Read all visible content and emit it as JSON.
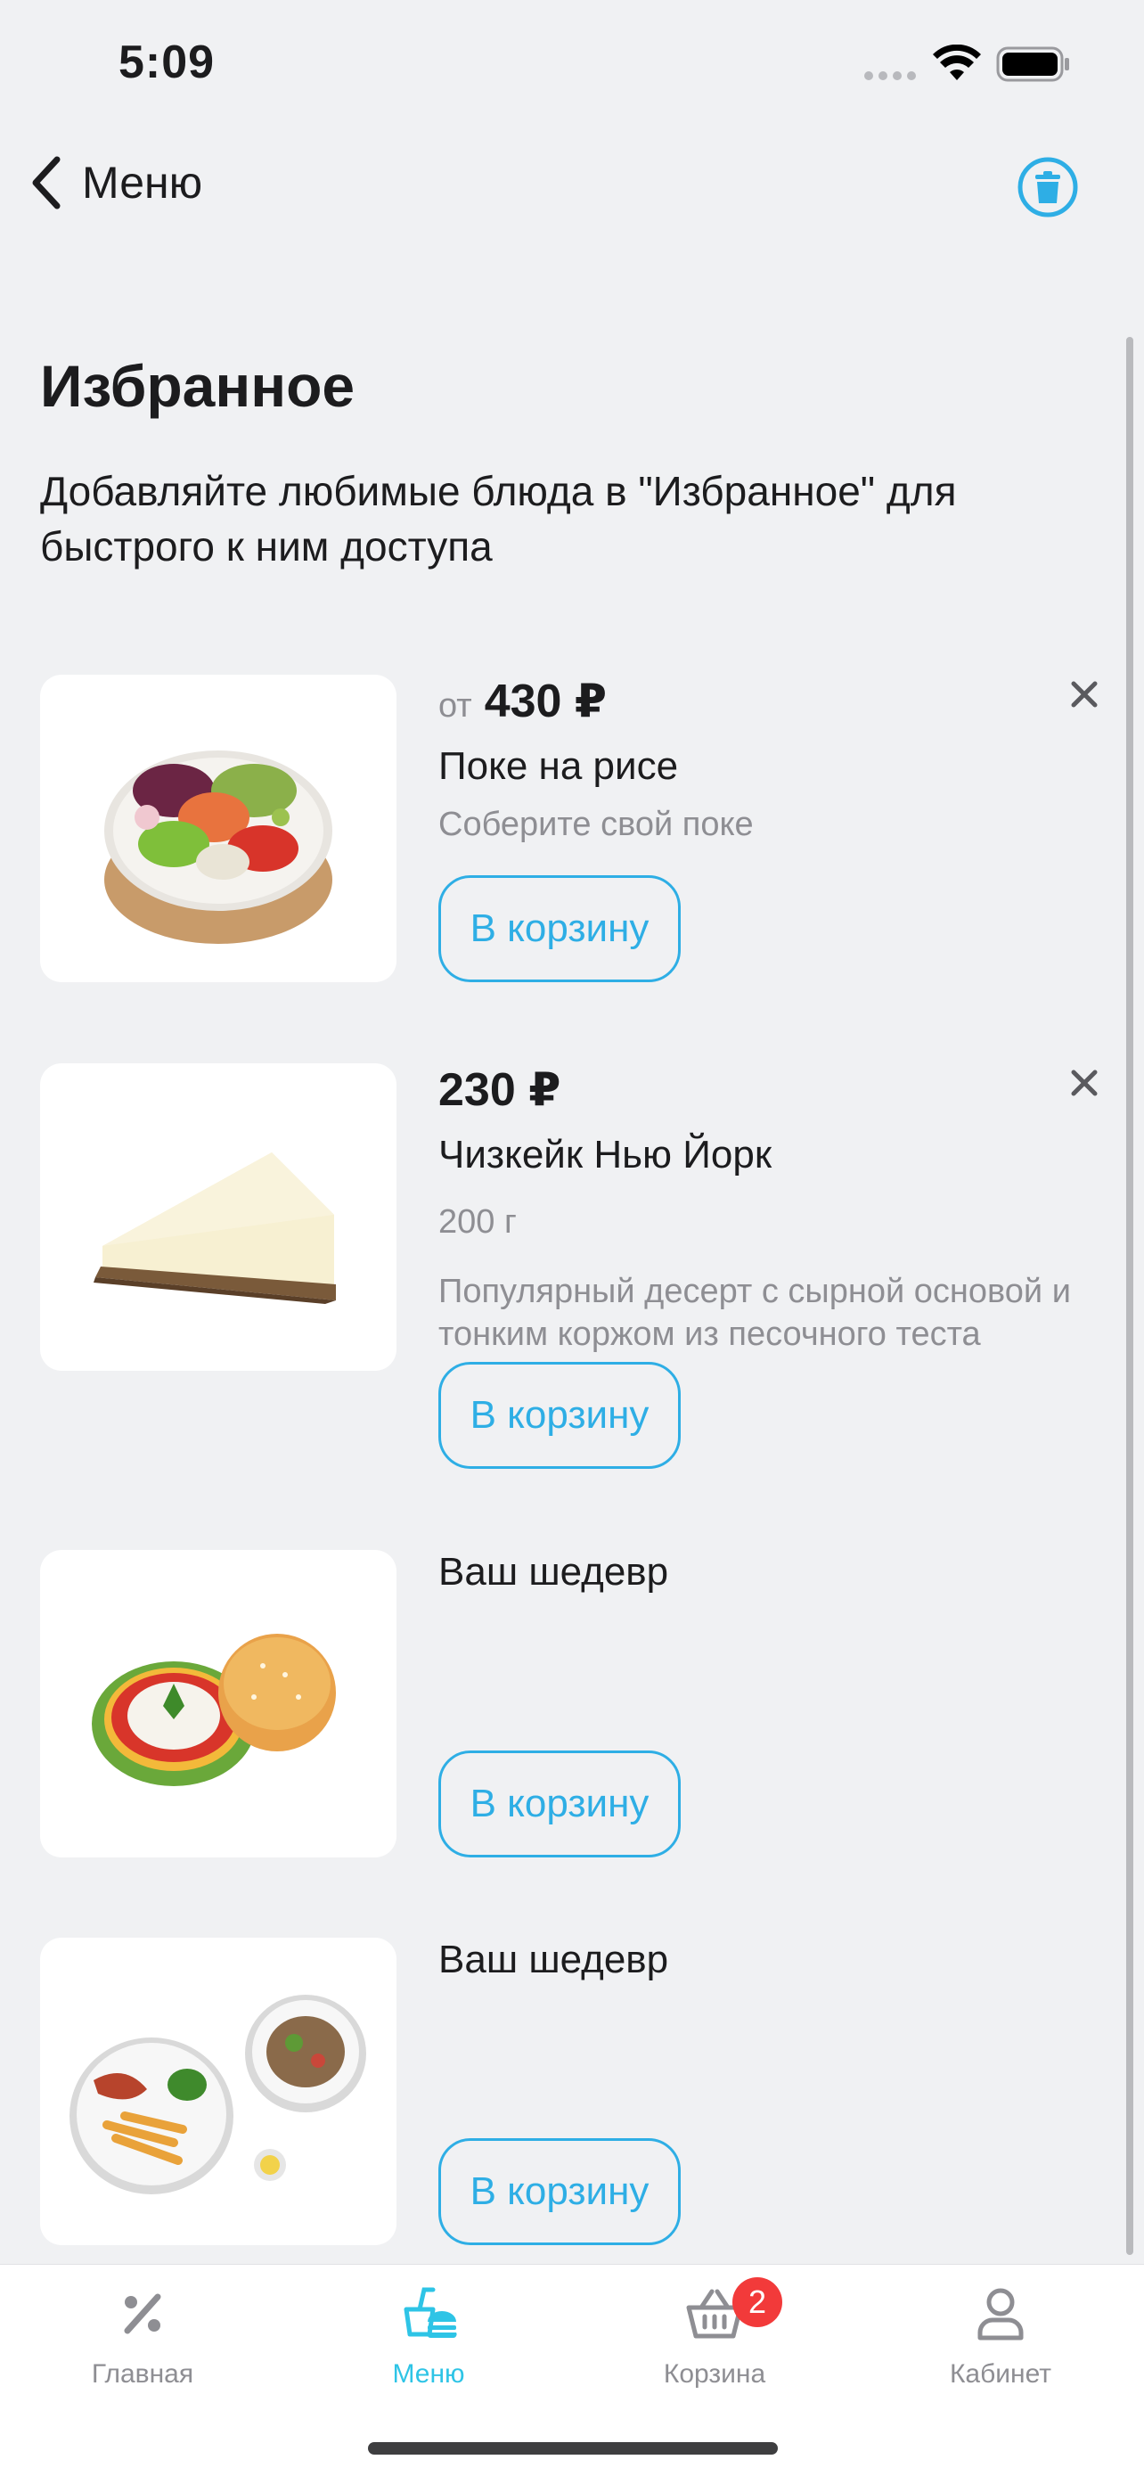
{
  "status_bar": {
    "time": "5:09"
  },
  "nav": {
    "back_label": "Меню"
  },
  "header": {
    "title": "Избранное",
    "subtitle": "Добавляйте любимые блюда в \"Избранное\" для быстрого к ним доступа"
  },
  "items": [
    {
      "price_prefix": "от",
      "price": "430 ₽",
      "name": "Поке на рисе",
      "weight": "",
      "description": "Соберите свой поке",
      "cart_label": "В корзину",
      "image": "poke-bowl"
    },
    {
      "price_prefix": "",
      "price": "230 ₽",
      "name": "Чизкейк Нью Йорк",
      "weight": "200 г",
      "description": "Популярный десерт с сырной основой и тонким коржом из песочного теста",
      "cart_label": "В корзину",
      "image": "cheesecake"
    },
    {
      "price_prefix": "",
      "price": "",
      "name": "Ваш шедевр",
      "weight": "",
      "description": "",
      "cart_label": "В корзину",
      "image": "burger"
    },
    {
      "price_prefix": "",
      "price": "",
      "name": "Ваш шедевр",
      "weight": "",
      "description": "",
      "cart_label": "В корзину",
      "image": "breakfast-plates"
    }
  ],
  "tabs": [
    {
      "label": "Главная",
      "icon": "percent-icon",
      "active": false
    },
    {
      "label": "Меню",
      "icon": "food-menu-icon",
      "active": true
    },
    {
      "label": "Корзина",
      "icon": "basket-icon",
      "active": false,
      "badge": "2"
    },
    {
      "label": "Кабинет",
      "icon": "person-icon",
      "active": false
    }
  ],
  "colors": {
    "accent": "#2eaee5",
    "tab_active": "#2ec4e6",
    "badge": "#f23a3a",
    "background": "#f0f1f3"
  }
}
